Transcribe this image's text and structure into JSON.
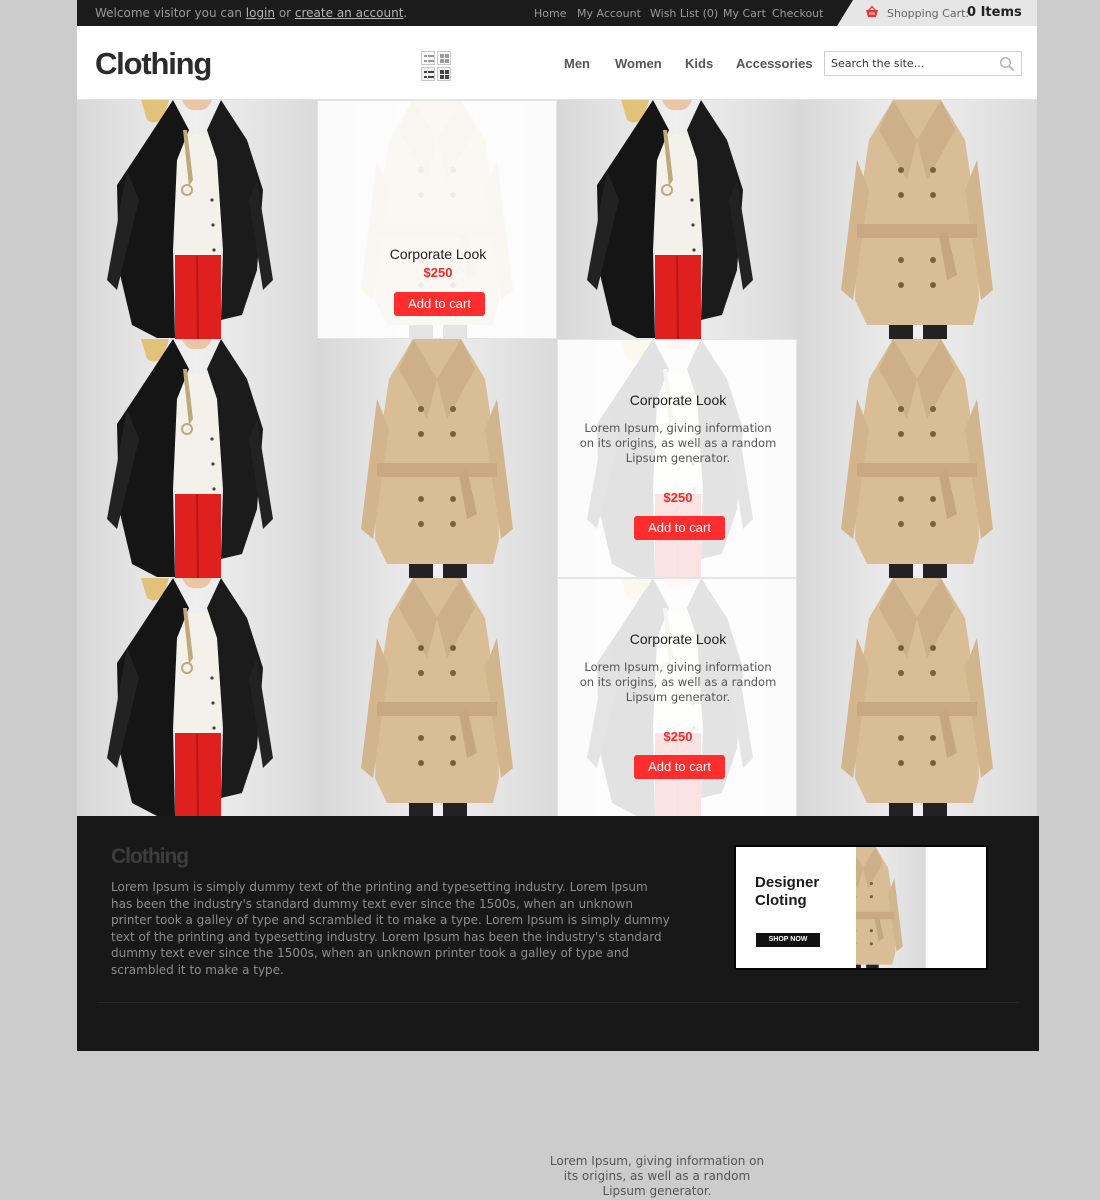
{
  "topbar": {
    "welcome_prefix": "Welcome visitor you can ",
    "login_link": "login",
    "or_text": " or ",
    "create_account_link": "create an account",
    "period": ".",
    "links": [
      "Home",
      "My Account",
      "Wish List (0)",
      "My Cart",
      "Checkout"
    ],
    "cart_label": "Shopping Cart:",
    "cart_count": "0 Items"
  },
  "header": {
    "logo": "Clothing",
    "nav": [
      "Men",
      "Women",
      "Kids",
      "Accessories"
    ],
    "search_placeholder": "Search the site..."
  },
  "products": {
    "title": "Corporate Look",
    "price": "$250",
    "button": "Add to cart",
    "description": "Lorem Ipsum, giving information on its origins, as well as a random Lipsum generator."
  },
  "footer": {
    "logo": "Clothing",
    "text": "Lorem Ipsum is simply dummy text of the printing and typesetting industry. Lorem Ipsum has been the industry's standard dummy text ever since the 1500s, when an unknown printer took a galley of type and scrambled it to make a type. Lorem Ipsum is simply dummy text of the printing and typesetting industry. Lorem Ipsum has been the industry's standard dummy text ever since the 1500s, when an unknown printer took a galley of type and scrambled it to make a type.",
    "banner_title": "Designer\nCloting",
    "banner_button": "SHOP NOW"
  },
  "stray_text": "Lorem Ipsum, giving information on its origins, as well as a random Lipsum generator.",
  "colors": {
    "accent_red": "#ff2d2d",
    "price_red": "#ee2b2b",
    "topbar": "#1b1b1b",
    "footer": "#181818",
    "page_bg": "#cccccc"
  }
}
